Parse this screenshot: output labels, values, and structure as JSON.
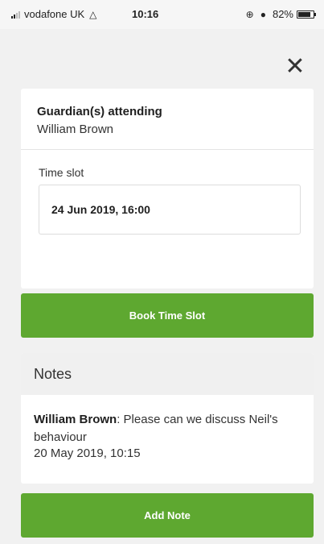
{
  "status_bar": {
    "carrier": "vodafone UK",
    "time": "10:16",
    "battery_percent": "82%",
    "battery_level": 0.82,
    "icons": [
      "signal-icon",
      "wifi-icon",
      "location-icon",
      "alarm-icon",
      "battery-icon"
    ]
  },
  "close": {
    "label": "✕"
  },
  "booking": {
    "guardian_label": "Guardian(s) attending",
    "guardian_name": "William Brown",
    "time_slot_label": "Time slot",
    "time_slot_value": "24 Jun 2019, 16:00",
    "book_button_label": "Book Time Slot"
  },
  "notes": {
    "header": "Notes",
    "items": [
      {
        "author": "William Brown",
        "text": ": Please can we discuss Neil's behaviour",
        "timestamp": "20 May 2019, 10:15"
      }
    ],
    "add_button_label": "Add Note"
  },
  "colors": {
    "accent_green": "#5ea830",
    "background": "#f1f1f1",
    "card": "#ffffff"
  }
}
